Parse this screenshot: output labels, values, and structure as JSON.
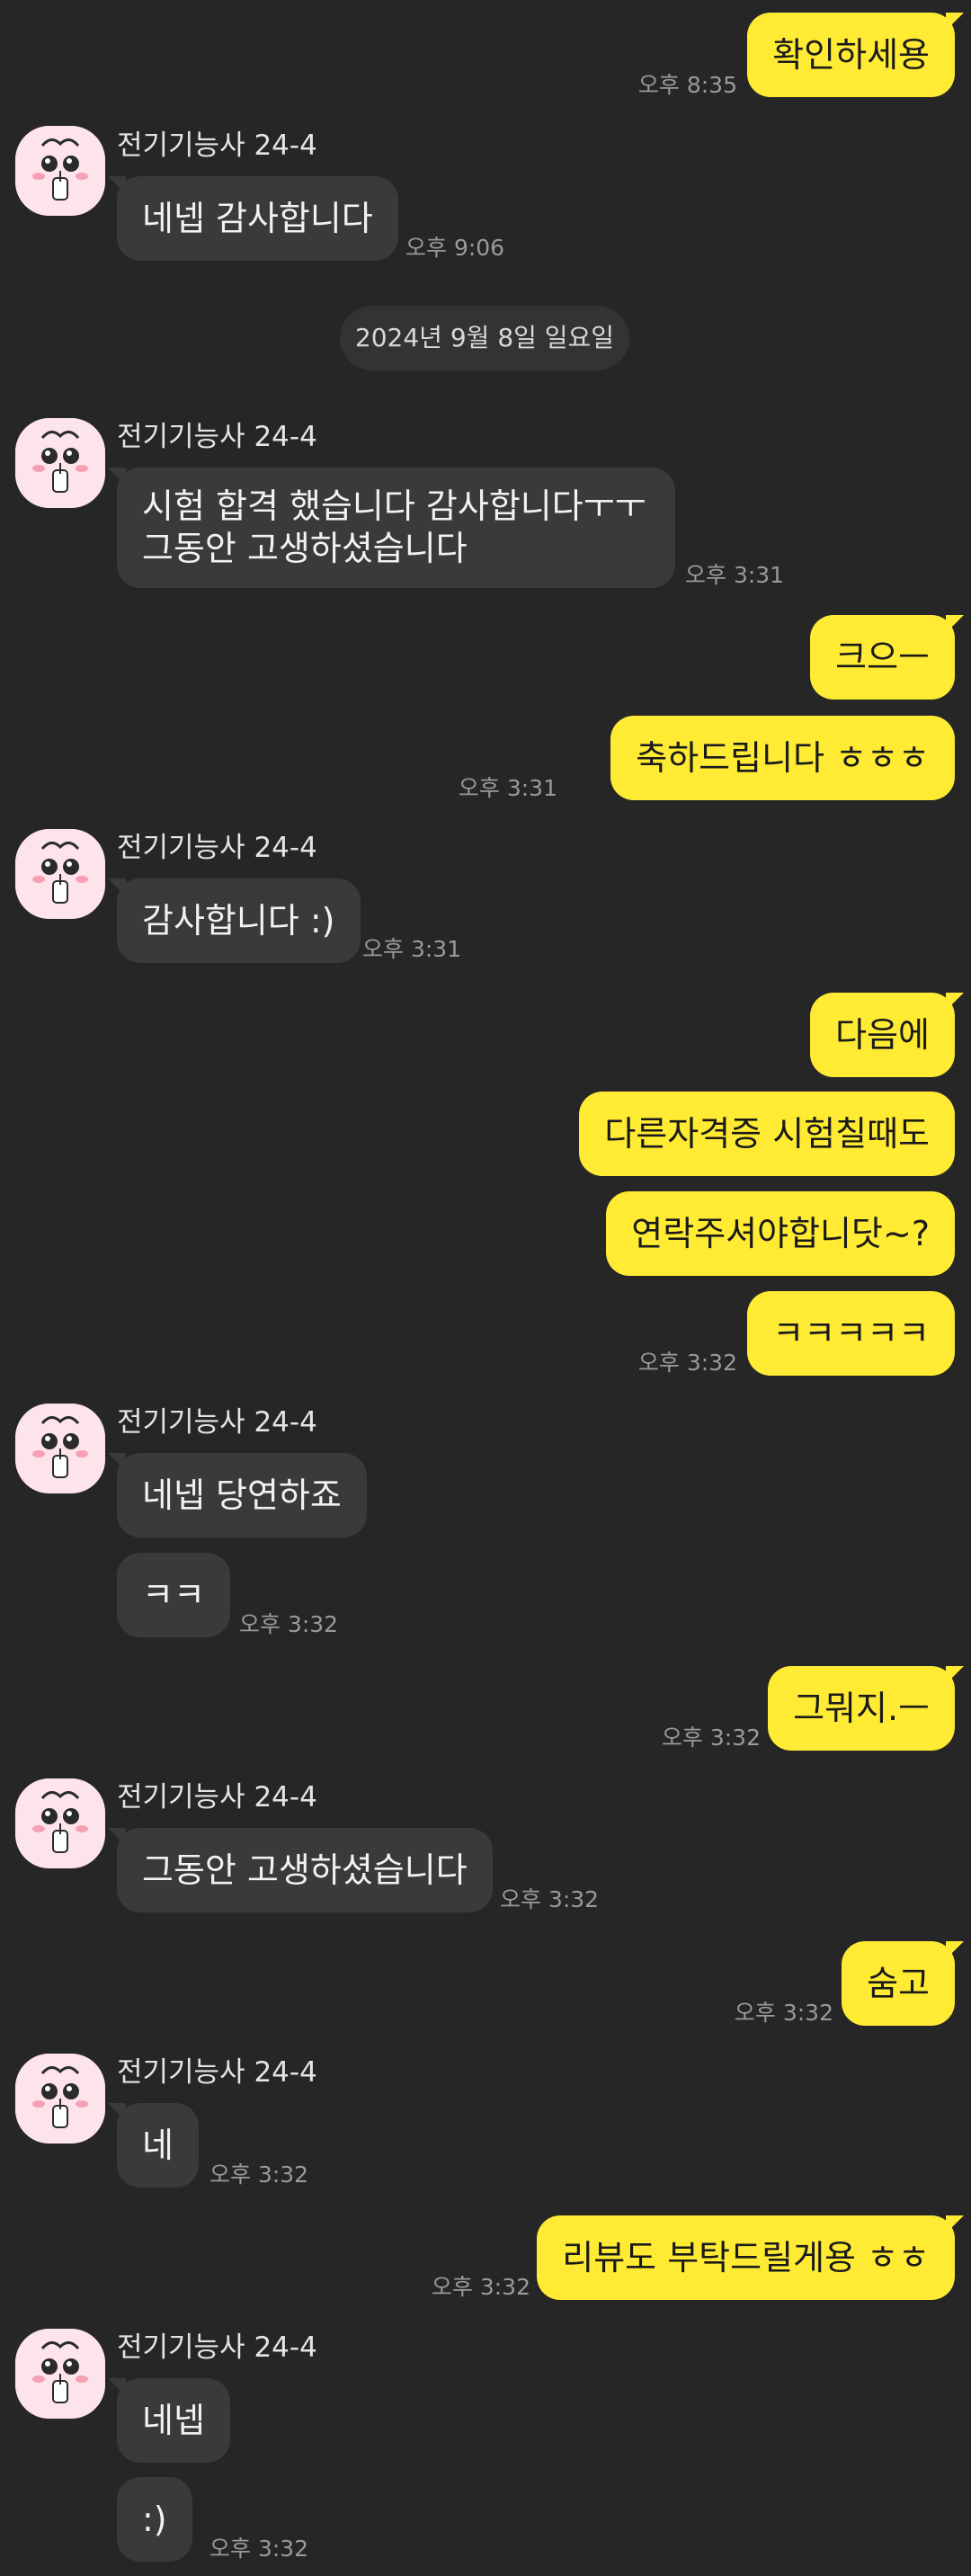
{
  "sender_name": "전기기능사 24-4",
  "date_divider": "2024년 9월 8일 일요일",
  "messages": {
    "m1": {
      "text": "확인하세용",
      "time": "오후 8:35"
    },
    "m2": {
      "text": "네넵 감사합니다",
      "time": "오후 9:06"
    },
    "m3": {
      "text": "시험 합격 했습니다 감사합니다ㅜㅜ\n그동안 고생하셨습니다",
      "time": "오후 3:31"
    },
    "m4": {
      "text": "크으ㅡ"
    },
    "m5": {
      "text": "축하드립니다 ㅎㅎㅎ",
      "time": "오후 3:31"
    },
    "m6": {
      "text": "감사합니다 :)",
      "time": "오후 3:31"
    },
    "m7": {
      "text": "다음에"
    },
    "m8": {
      "text": "다른자격증 시험칠때도"
    },
    "m9": {
      "text": "연락주셔야합니닷~?"
    },
    "m10": {
      "text": "ㅋㅋㅋㅋㅋ",
      "time": "오후 3:32"
    },
    "m11": {
      "text": "네넵 당연하죠"
    },
    "m12": {
      "text": "ㅋㅋ",
      "time": "오후 3:32"
    },
    "m13": {
      "text": "그뭐지.ㅡ",
      "time": "오후 3:32"
    },
    "m14": {
      "text": "그동안 고생하셨습니다",
      "time": "오후 3:32"
    },
    "m15": {
      "text": "숨고",
      "time": "오후 3:32"
    },
    "m16": {
      "text": "네",
      "time": "오후 3:32"
    },
    "m17": {
      "text": "리뷰도 부탁드릴게용 ㅎㅎ",
      "time": "오후 3:32"
    },
    "m18": {
      "text": "네넵"
    },
    "m19": {
      "text": ":)",
      "time": "오후 3:32"
    }
  },
  "colors": {
    "background": "#262626",
    "outgoing_bubble": "#ffeb33",
    "incoming_bubble": "#3a3a3a",
    "avatar_background": "#fde3ea"
  },
  "avatar_icon": "peach-character-icon"
}
